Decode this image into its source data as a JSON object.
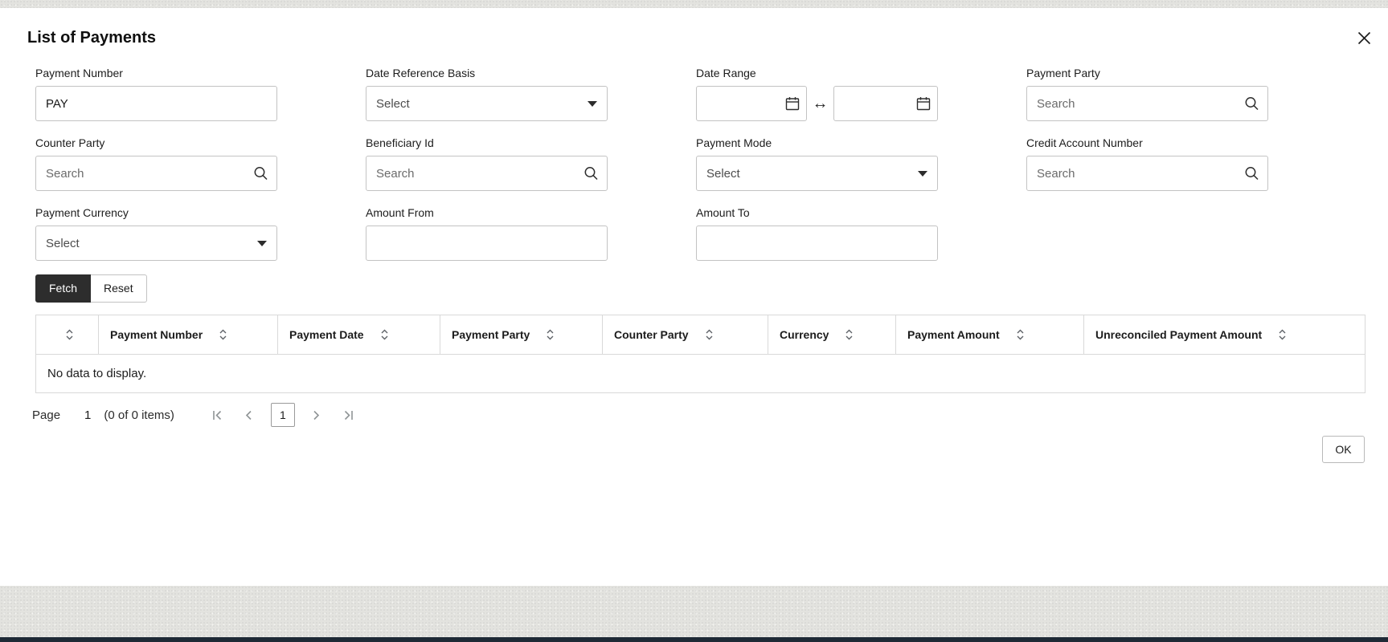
{
  "dialog": {
    "title": "List of Payments"
  },
  "colors": {
    "fetch_button_bg": "#2d2d2d",
    "bottom_bar": "#1f2a36",
    "desktop_texture": "#e3e3df",
    "input_border": "#c3c3c3"
  },
  "icons": {
    "close": "x-cross",
    "search": "magnifier",
    "calendar": "calendar-grid",
    "caret": "filled-triangle-down",
    "range_separator": "left-right-arrow",
    "sort": "up-down-chevrons",
    "pagination": [
      "first-page",
      "previous-page",
      "next-page",
      "last-page"
    ]
  },
  "filters": {
    "payment_number": {
      "label": "Payment Number",
      "value": "PAY"
    },
    "date_reference_basis": {
      "label": "Date Reference Basis",
      "value": "Select"
    },
    "date_range": {
      "label": "Date Range",
      "from_value": "",
      "to_value": "",
      "separator": "↔"
    },
    "payment_party": {
      "label": "Payment Party",
      "placeholder": "Search"
    },
    "counter_party": {
      "label": "Counter Party",
      "placeholder": "Search"
    },
    "beneficiary_id": {
      "label": "Beneficiary Id",
      "placeholder": "Search"
    },
    "payment_mode": {
      "label": "Payment Mode",
      "value": "Select"
    },
    "credit_account_number": {
      "label": "Credit Account Number",
      "placeholder": "Search"
    },
    "payment_currency": {
      "label": "Payment Currency",
      "value": "Select"
    },
    "amount_from": {
      "label": "Amount From",
      "value": ""
    },
    "amount_to": {
      "label": "Amount To",
      "value": ""
    }
  },
  "actions": {
    "fetch": "Fetch",
    "reset": "Reset",
    "ok": "OK"
  },
  "table": {
    "columns": [
      "",
      "Payment Number",
      "Payment Date",
      "Payment Party",
      "Counter Party",
      "Currency",
      "Payment Amount",
      "Unreconciled Payment Amount"
    ],
    "empty_message": "No data to display."
  },
  "pagination": {
    "page_label": "Page",
    "current_page": "1",
    "items_summary": "(0 of 0 items)",
    "page_button": "1"
  }
}
